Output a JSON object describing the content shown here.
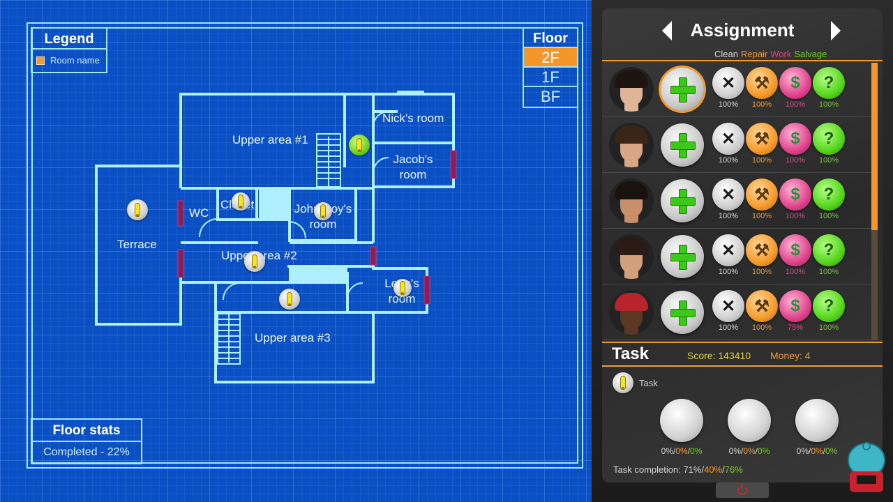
{
  "legend": {
    "title": "Legend",
    "item_label": "Room name",
    "item_color": "#f59a2c"
  },
  "floor": {
    "title": "Floor",
    "options": [
      "2F",
      "1F",
      "BF"
    ],
    "selected": "2F"
  },
  "floor_stats": {
    "title": "Floor stats",
    "completed": "Completed - 22%"
  },
  "rooms": {
    "nicks_room": "Nick's room",
    "upper_area_1": "Upper area #1",
    "jacobs_room": "Jacob's room",
    "terrace": "Terrace",
    "wc": "WC",
    "closet": "Closet",
    "john_boys_room": "John Boy's room",
    "upper_area_2": "Upper area #2",
    "leons_room": "Leon's room",
    "upper_area_3": "Upper area #3"
  },
  "assignment": {
    "title": "Assignment",
    "categories": {
      "clean": "Clean",
      "repair": "Repair",
      "work": "Work",
      "salvage": "Salvage"
    },
    "characters": [
      {
        "clean": "100%",
        "repair": "100%",
        "work": "100%",
        "salvage": "100%",
        "selected": true
      },
      {
        "clean": "100%",
        "repair": "100%",
        "work": "100%",
        "salvage": "100%",
        "selected": false
      },
      {
        "clean": "100%",
        "repair": "100%",
        "work": "100%",
        "salvage": "100%",
        "selected": false
      },
      {
        "clean": "100%",
        "repair": "100%",
        "work": "100%",
        "salvage": "100%",
        "selected": false
      },
      {
        "clean": "100%",
        "repair": "100%",
        "work": "75%",
        "salvage": "100%",
        "selected": false
      }
    ],
    "scroll_position": 0.0
  },
  "task": {
    "title": "Task",
    "score": "Score: 143410",
    "money": "Money: 4",
    "legend_label": "Task",
    "slots": [
      {
        "a": "0%",
        "b": "0%",
        "c": "0%"
      },
      {
        "a": "0%",
        "b": "0%",
        "c": "0%"
      },
      {
        "a": "0%",
        "b": "0%",
        "c": "0%"
      }
    ],
    "completion_prefix": "Task completion: ",
    "completion_a": "71%",
    "completion_b": "40%",
    "completion_c": "76%"
  },
  "icons": {
    "nav_prev": "chevron-left-icon",
    "nav_next": "chevron-right-icon",
    "clean": "broom-icon",
    "repair": "hammer-icon",
    "work": "money-icon",
    "salvage": "question-icon",
    "power": "power-icon"
  },
  "colors": {
    "blueprint": "#0b4fc4",
    "line": "#9fe6ff",
    "accent": "#f59a2c",
    "door": "#8a1e5a"
  }
}
